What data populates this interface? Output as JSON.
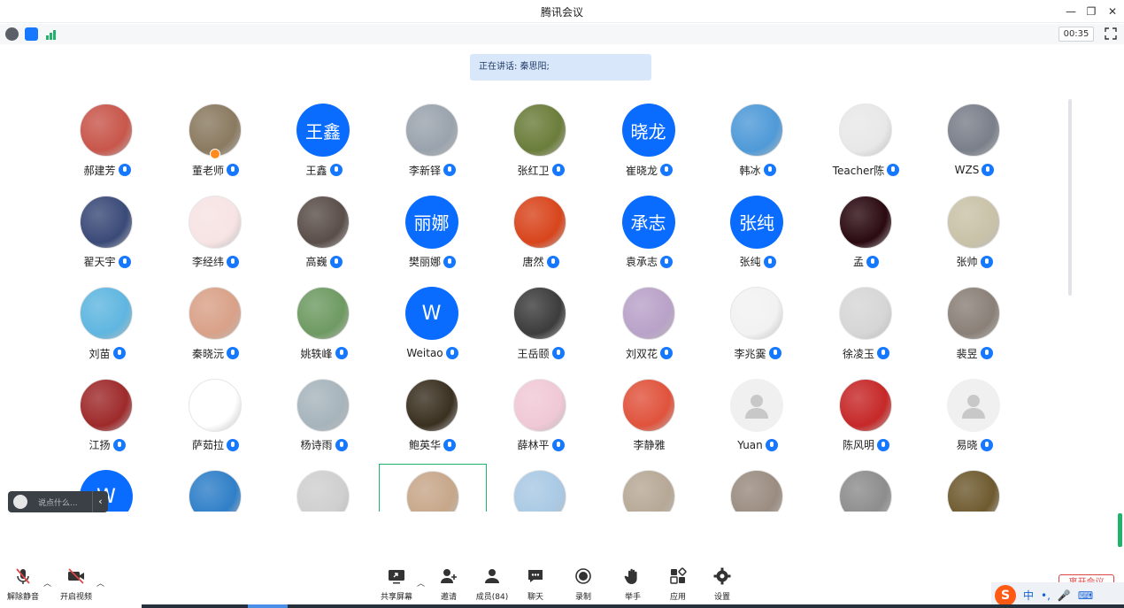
{
  "window": {
    "title": "腾讯会议"
  },
  "infobar": {
    "timer": "00:35"
  },
  "speaking": {
    "text": "正在讲话: 秦思阳;"
  },
  "participants": [
    {
      "name": "郝建芳",
      "avatar": "photo",
      "color": "#c8564b"
    },
    {
      "name": "董老师",
      "avatar": "photo",
      "color": "#8a7a60",
      "host": true
    },
    {
      "name": "王鑫",
      "avatar": "text",
      "text": "王鑫"
    },
    {
      "name": "李新铎",
      "avatar": "photo",
      "color": "#9aa3ad"
    },
    {
      "name": "张红卫",
      "avatar": "photo",
      "color": "#6b7d3a"
    },
    {
      "name": "崔晓龙",
      "avatar": "text",
      "text": "晓龙"
    },
    {
      "name": "韩冰",
      "avatar": "photo",
      "color": "#4f9ad8"
    },
    {
      "name": "Teacher陈",
      "avatar": "photo",
      "color": "#e8e8e8"
    },
    {
      "name": "WZS",
      "avatar": "photo",
      "color": "#7a7f8a"
    },
    {
      "name": "翟天宇",
      "avatar": "photo",
      "color": "#3a4a78"
    },
    {
      "name": "李经纬",
      "avatar": "photo",
      "color": "#f7e3e3"
    },
    {
      "name": "高巍",
      "avatar": "photo",
      "color": "#5a4e49"
    },
    {
      "name": "樊丽娜",
      "avatar": "text",
      "text": "丽娜"
    },
    {
      "name": "唐然",
      "avatar": "photo",
      "color": "#d8451c"
    },
    {
      "name": "袁承志",
      "avatar": "text",
      "text": "承志"
    },
    {
      "name": "张纯",
      "avatar": "text",
      "text": "张纯"
    },
    {
      "name": "孟",
      "avatar": "photo",
      "color": "#2a0a10"
    },
    {
      "name": "张帅",
      "avatar": "photo",
      "color": "#c9c2a8"
    },
    {
      "name": "刘苗",
      "avatar": "photo",
      "color": "#5fb6e0"
    },
    {
      "name": "秦晓沅",
      "avatar": "photo",
      "color": "#d9a188"
    },
    {
      "name": "姚轶峰",
      "avatar": "photo",
      "color": "#6e9a62"
    },
    {
      "name": "Weitao",
      "avatar": "text",
      "text": "W"
    },
    {
      "name": "王岳颐",
      "avatar": "photo",
      "color": "#3c3c3c"
    },
    {
      "name": "刘双花",
      "avatar": "photo",
      "color": "#b9a2c8"
    },
    {
      "name": "李兆霙",
      "avatar": "photo",
      "color": "#f2f2f2"
    },
    {
      "name": "徐凌玉",
      "avatar": "photo",
      "color": "#d6d6d6"
    },
    {
      "name": "裴昱",
      "avatar": "photo",
      "color": "#8a8078"
    },
    {
      "name": "江扬",
      "avatar": "photo",
      "color": "#9e2a2b"
    },
    {
      "name": "萨茹拉",
      "avatar": "photo",
      "color": "#ffffff"
    },
    {
      "name": "杨诗雨",
      "avatar": "photo",
      "color": "#a7b4bc"
    },
    {
      "name": "鲍英华",
      "avatar": "photo",
      "color": "#3a3020"
    },
    {
      "name": "薛林平",
      "avatar": "photo",
      "color": "#f0c8d6"
    },
    {
      "name": "李静雅",
      "avatar": "photo",
      "color": "#e0533c",
      "nomic": true
    },
    {
      "name": "Yuan",
      "avatar": "placeholder"
    },
    {
      "name": "陈风明",
      "avatar": "photo",
      "color": "#c62828"
    },
    {
      "name": "易晓",
      "avatar": "placeholder"
    },
    {
      "name": "",
      "avatar": "text",
      "text": "W"
    },
    {
      "name": "",
      "avatar": "photo",
      "color": "#2f7fc8"
    },
    {
      "name": "",
      "avatar": "photo",
      "color": "#cfcfcf"
    },
    {
      "name": "",
      "avatar": "photo",
      "color": "#c7a78a",
      "active": true
    },
    {
      "name": "",
      "avatar": "photo",
      "color": "#a9c9e4"
    },
    {
      "name": "",
      "avatar": "photo",
      "color": "#b7a896"
    },
    {
      "name": "",
      "avatar": "photo",
      "color": "#9a8c80"
    },
    {
      "name": "",
      "avatar": "photo",
      "color": "#8d8d8d"
    },
    {
      "name": "",
      "avatar": "photo",
      "color": "#6e5a2f"
    }
  ],
  "chat": {
    "placeholder": "说点什么..."
  },
  "toolbar": {
    "unmute": "解除静音",
    "video": "开启视频",
    "share": "共享屏幕",
    "invite": "邀请",
    "members": "成员(84)",
    "chat": "聊天",
    "record": "录制",
    "raise_hand": "举手",
    "apps": "应用",
    "settings": "设置",
    "end": "离开会议"
  },
  "ime": {
    "lang": "中"
  }
}
